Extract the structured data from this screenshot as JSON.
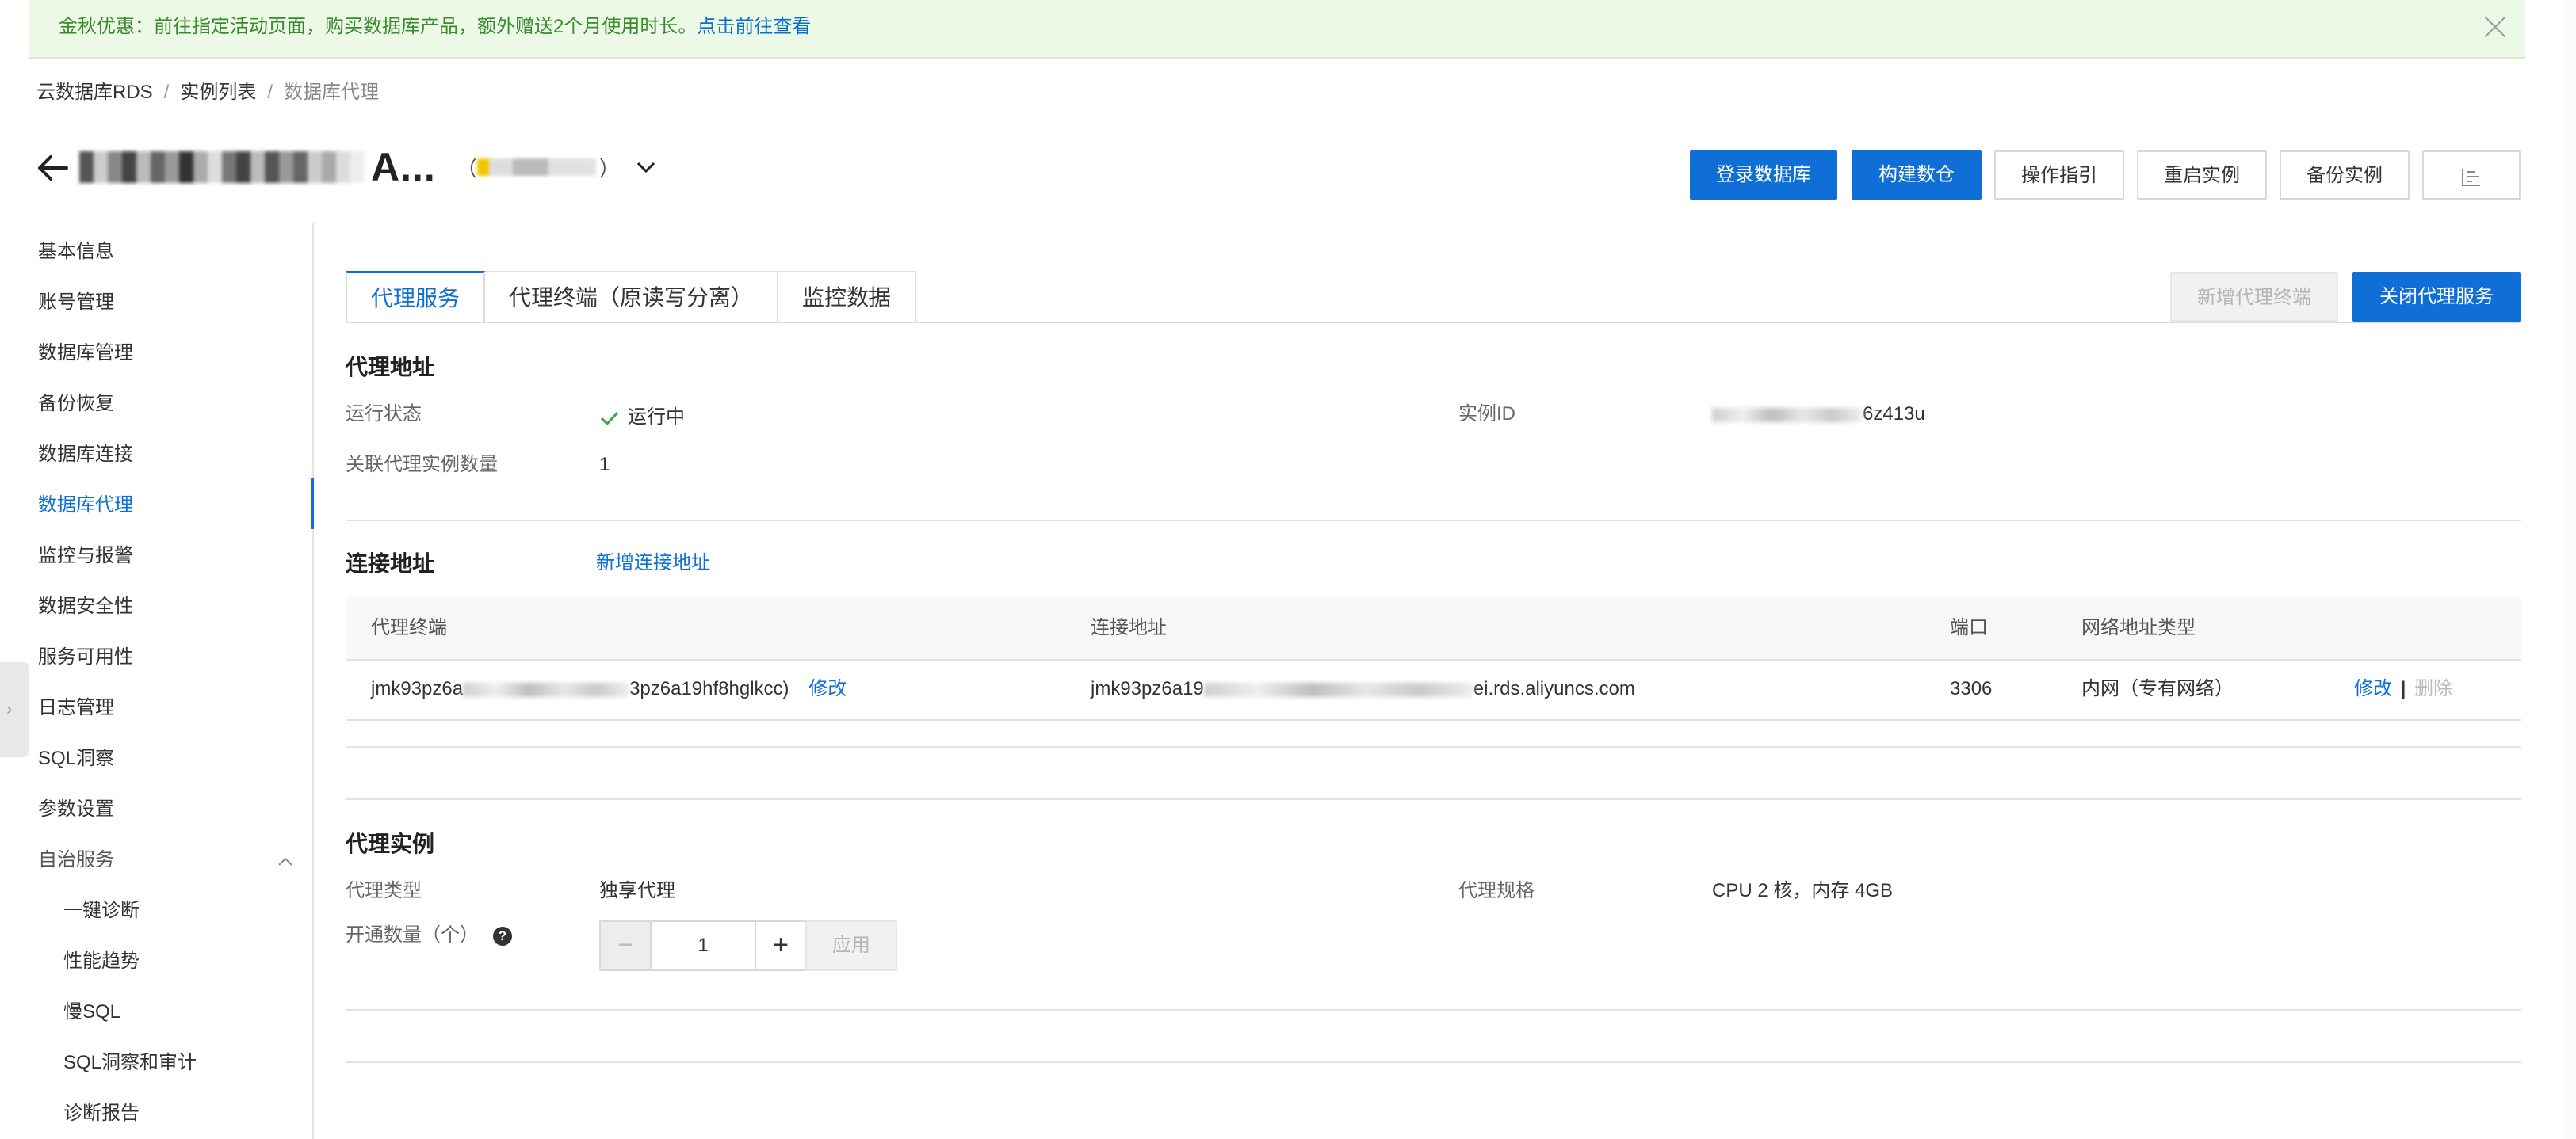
{
  "promo": {
    "text": "金秋优惠：前往指定活动页面，购买数据库产品，额外赠送2个月使用时长。",
    "link": "点击前往查看"
  },
  "breadcrumb": [
    "云数据库RDS",
    "实例列表",
    "数据库代理"
  ],
  "header": {
    "title_suffix": "A...",
    "paren_open": "（",
    "paren_close": "）"
  },
  "toolbar": {
    "login_db": "登录数据库",
    "build_dw": "构建数仓",
    "guide": "操作指引",
    "restart": "重启实例",
    "backup": "备份实例"
  },
  "sidebar": {
    "items": [
      "基本信息",
      "账号管理",
      "数据库管理",
      "备份恢复",
      "数据库连接",
      "数据库代理",
      "监控与报警",
      "数据安全性",
      "服务可用性",
      "日志管理",
      "SQL洞察",
      "参数设置",
      "自治服务"
    ],
    "sub_items": [
      "一键诊断",
      "性能趋势",
      "慢SQL",
      "SQL洞察和审计",
      "诊断报告"
    ]
  },
  "tabs": [
    "代理服务",
    "代理终端（原读写分离）",
    "监控数据"
  ],
  "actions": {
    "add_terminal": "新增代理终端",
    "close_proxy": "关闭代理服务"
  },
  "proxy_address": {
    "title": "代理地址",
    "status_label": "运行状态",
    "status_value": "运行中",
    "instance_id_label": "实例ID",
    "instance_id_suffix": "6z413u",
    "count_label": "关联代理实例数量",
    "count_value": "1"
  },
  "connection": {
    "title": "连接地址",
    "add_link": "新增连接地址",
    "columns": [
      "代理终端",
      "连接地址",
      "端口",
      "网络地址类型"
    ],
    "row": {
      "terminal_prefix": "jmk93pz6a",
      "terminal_suffix": "3pz6a19hf8hglkcc)",
      "terminal_edit": "修改",
      "address_prefix": "jmk93pz6a19",
      "address_suffix": "ei.rds.aliyuncs.com",
      "port": "3306",
      "net_type": "内网（专有网络）",
      "edit": "修改",
      "sep": "|",
      "delete": "删除"
    }
  },
  "proxy_instance": {
    "title": "代理实例",
    "type_label": "代理类型",
    "type_value": "独享代理",
    "spec_label": "代理规格",
    "spec_value": "CPU 2 核，内存 4GB",
    "open_count_label": "开通数量（个）",
    "help": "?",
    "stepper_value": "1",
    "minus": "−",
    "plus": "+",
    "apply": "应用"
  }
}
